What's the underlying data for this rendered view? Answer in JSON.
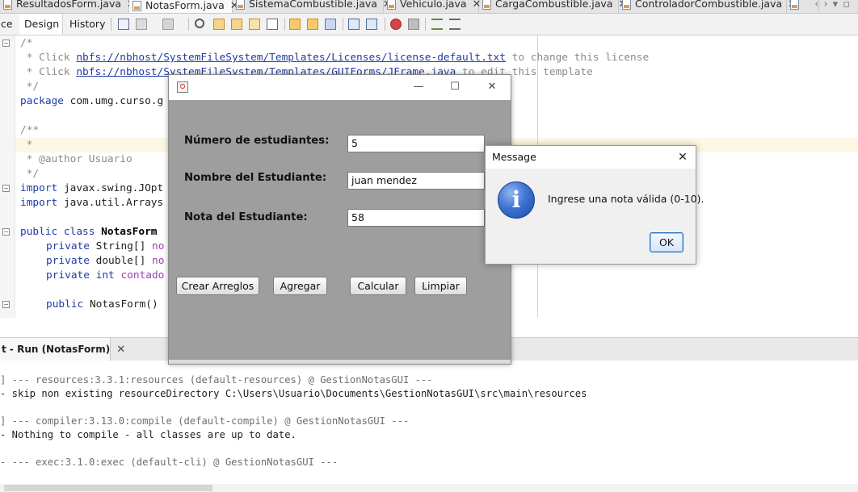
{
  "editor_tabs": [
    {
      "label": "ResultadosForm.java",
      "active": false
    },
    {
      "label": "NotasForm.java",
      "active": true
    },
    {
      "label": "SistemaCombustible.java",
      "active": false
    },
    {
      "label": "Vehiculo.java",
      "active": false
    },
    {
      "label": "CargaCombustible.java",
      "active": false
    },
    {
      "label": "ControladorCombustible.java",
      "active": false
    }
  ],
  "toolbar": {
    "source_tab": "ce",
    "design_tab": "Design",
    "history_tab": "History"
  },
  "code": {
    "l1": "/*",
    "l2_pre": " * Click ",
    "l2_link": "nbfs://nbhost/SystemFileSystem/Templates/Licenses/license-default.txt",
    "l2_post": " to change this license",
    "l3_pre": " * Click ",
    "l3_link": "nbfs://nbhost/SystemFileSystem/Templates/GUIForms/JFrame.java",
    "l3_post": " to edit this template",
    "l4": " */",
    "l5_kw": "package",
    "l5_rest": " com.umg.curso.g",
    "l7": "/**",
    "l8": " *",
    "l9": " * @author Usuario",
    "l10": " */",
    "l11_kw": "import",
    "l11_rest": " javax.swing.JOpt",
    "l12_kw": "import",
    "l12_rest": " java.util.Arrays",
    "l14_kw": "public class",
    "l14_name": " NotasForm",
    "l15_kw": "private",
    "l15_type": " String[]",
    "l15_field": " no",
    "l16_kw": "private",
    "l16_type": " double[]",
    "l16_field": " no",
    "l17_kw": "private int",
    "l17_field": " contado",
    "l19_kw": "public",
    "l19_rest": " NotasForm()"
  },
  "output": {
    "tab_label": "t - Run (NotasForm)",
    "lines": [
      "] --- resources:3.3.1:resources (default-resources) @ GestionNotasGUI ---",
      "- skip non existing resourceDirectory C:\\Users\\Usuario\\Documents\\GestionNotasGUI\\src\\main\\resources",
      "",
      "] --- compiler:3.13.0:compile (default-compile) @ GestionNotasGUI ---",
      "- Nothing to compile - all classes are up to date.",
      "",
      "- --- exec:3.1.0:exec (default-cli) @ GestionNotasGUI ---"
    ]
  },
  "notas_form": {
    "controls": {
      "minimize": "—",
      "maximize": "☐",
      "close": "✕"
    },
    "label_num": "Número de estudiantes:",
    "label_nombre": "Nombre del Estudiante:",
    "label_nota": "Nota del Estudiante:",
    "value_num": "5",
    "value_nombre": "juan mendez",
    "value_nota": "58",
    "btn_crear": "Crear Arreglos",
    "btn_agregar": "Agregar",
    "btn_calcular": "Calcular",
    "btn_limpiar": "Limpiar"
  },
  "message_dialog": {
    "title": "Message",
    "close": "✕",
    "icon_glyph": "i",
    "text": "Ingrese una nota válida (0-10).",
    "ok": "OK"
  }
}
